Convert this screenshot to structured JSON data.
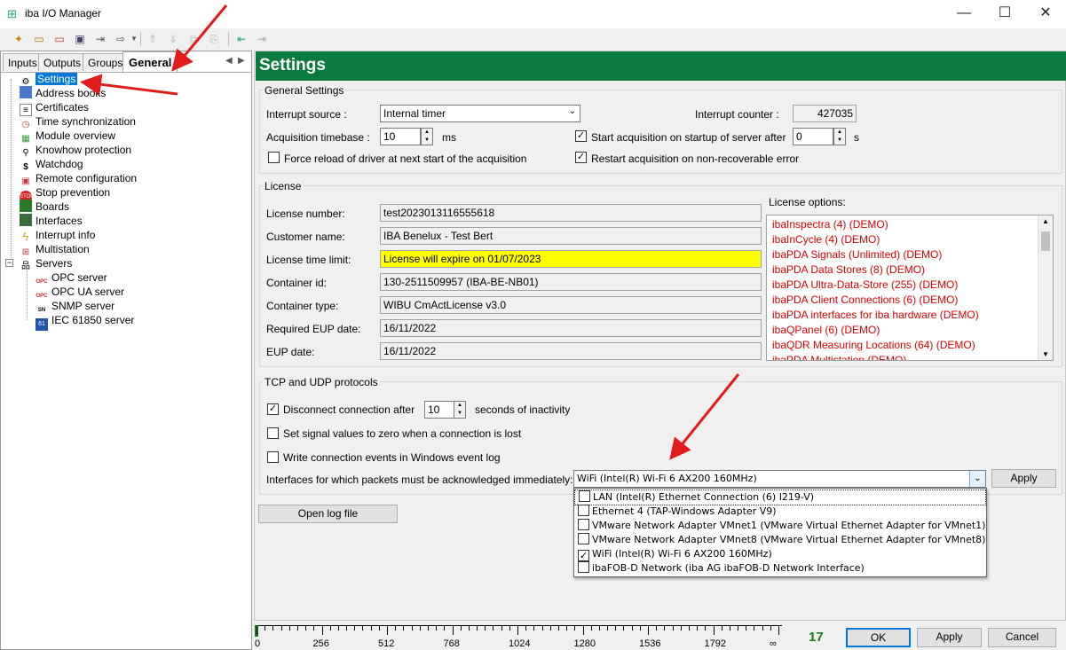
{
  "window": {
    "title": "iba I/O Manager",
    "minimize": "—",
    "maximize": "☐",
    "close": "✕"
  },
  "tabs": [
    "Inputs",
    "Outputs",
    "Groups",
    "General"
  ],
  "tree": {
    "items": [
      {
        "label": "Settings",
        "icon": "gear-icon"
      },
      {
        "label": "Address books",
        "icon": "address-book-icon"
      },
      {
        "label": "Certificates",
        "icon": "certificate-icon"
      },
      {
        "label": "Time synchronization",
        "icon": "clock-icon"
      },
      {
        "label": "Module overview",
        "icon": "module-icon"
      },
      {
        "label": "Knowhow protection",
        "icon": "key-icon"
      },
      {
        "label": "Watchdog",
        "icon": "watchdog-icon"
      },
      {
        "label": "Remote configuration",
        "icon": "remote-icon"
      },
      {
        "label": "Stop prevention",
        "icon": "stop-icon"
      },
      {
        "label": "Boards",
        "icon": "board-icon"
      },
      {
        "label": "Interfaces",
        "icon": "interface-icon"
      },
      {
        "label": "Interrupt info",
        "icon": "lightning-icon"
      },
      {
        "label": "Multistation",
        "icon": "multistation-icon"
      },
      {
        "label": "Servers",
        "icon": "servers-icon"
      }
    ],
    "servers": [
      {
        "label": "OPC server",
        "icon": "opc-icon",
        "badge": "OPC"
      },
      {
        "label": "OPC UA server",
        "icon": "opcua-icon",
        "badge": "OPC"
      },
      {
        "label": "SNMP server",
        "icon": "snmp-icon",
        "badge": "SN"
      },
      {
        "label": "IEC 61850 server",
        "icon": "iec-icon",
        "badge": "61"
      }
    ]
  },
  "header": {
    "title": "Settings"
  },
  "general": {
    "group_label": "General Settings",
    "interrupt_source_label": "Interrupt source :",
    "interrupt_source_value": "Internal timer",
    "interrupt_counter_label": "Interrupt counter :",
    "interrupt_counter_value": "427035",
    "acq_timebase_label": "Acquisition timebase :",
    "acq_timebase_value": "10",
    "acq_timebase_unit": "ms",
    "start_acq_label": "Start acquisition on startup of server after",
    "start_acq_value": "0",
    "start_acq_unit": "s",
    "force_reload_label": "Force reload of driver at next start of the acquisition",
    "restart_label": "Restart acquisition on non-recoverable error"
  },
  "license": {
    "group_label": "License",
    "fields": [
      {
        "label": "License number:",
        "value": "test2023013116555618"
      },
      {
        "label": "Customer name:",
        "value": "IBA Benelux - Test Bert"
      },
      {
        "label": "License time limit:",
        "value": "License will expire on 01/07/2023"
      },
      {
        "label": "Container id:",
        "value": "130-2511509957 (IBA-BE-NB01)"
      },
      {
        "label": "Container type:",
        "value": "WIBU CmActLicense v3.0"
      },
      {
        "label": "Required EUP date:",
        "value": "16/11/2022"
      },
      {
        "label": "EUP date:",
        "value": "16/11/2022"
      }
    ],
    "options_label": "License options:",
    "options": [
      "ibaInspectra (4) (DEMO)",
      "ibaInCycle (4) (DEMO)",
      "ibaPDA Signals (Unlimited) (DEMO)",
      "ibaPDA Data Stores (8) (DEMO)",
      "ibaPDA Ultra-Data-Store (255) (DEMO)",
      "ibaPDA Client Connections (6) (DEMO)",
      "ibaPDA interfaces for iba hardware (DEMO)",
      "ibaQPanel (6) (DEMO)",
      "ibaQDR Measuring Locations (64) (DEMO)",
      "ibaPDA Multistation (DEMO)"
    ]
  },
  "tcp": {
    "group_label": "TCP and UDP protocols",
    "disconnect_label": "Disconnect connection after",
    "disconnect_value": "10",
    "disconnect_unit": "seconds of inactivity",
    "zero_label": "Set signal values to zero when a connection is lost",
    "events_label": "Write connection events in Windows event log",
    "interfaces_label": "Interfaces for which packets must be acknowledged immediately:",
    "interfaces_value": "WiFi (Intel(R) Wi-Fi 6 AX200 160MHz)",
    "apply_label": "Apply",
    "dropdown": [
      {
        "label": "LAN (Intel(R) Ethernet Connection (6) I219-V)",
        "checked": ""
      },
      {
        "label": "Ethernet 4 (TAP-Windows Adapter V9)",
        "checked": ""
      },
      {
        "label": "VMware Network Adapter VMnet1 (VMware Virtual Ethernet Adapter for VMnet1)",
        "checked": ""
      },
      {
        "label": "VMware Network Adapter VMnet8 (VMware Virtual Ethernet Adapter for VMnet8)",
        "checked": ""
      },
      {
        "label": "WiFi (Intel(R) Wi-Fi 6 AX200 160MHz)",
        "checked": "✓"
      },
      {
        "label": "ibaFOB-D Network (iba AG ibaFOB-D Network Interface)",
        "checked": ""
      }
    ]
  },
  "open_log_label": "Open log file",
  "footer": {
    "scale": [
      "0",
      "256",
      "512",
      "768",
      "1024",
      "1280",
      "1536",
      "1792",
      "∞"
    ],
    "count": "17",
    "ok": "OK",
    "apply": "Apply",
    "cancel": "Cancel"
  },
  "colors": {
    "header": "#0b7a3e",
    "accent": "#0078d7",
    "license_warning": "#ffff00",
    "demo_text": "#dd0000"
  }
}
